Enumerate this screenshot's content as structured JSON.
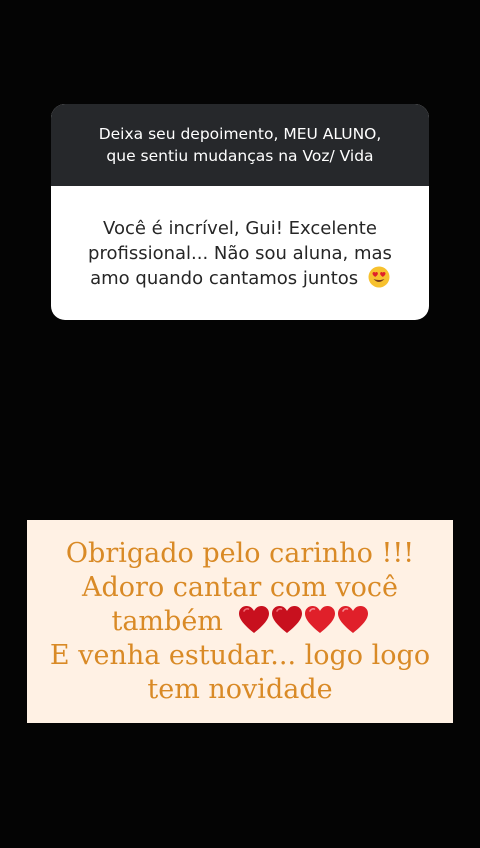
{
  "question_sticker": {
    "lines": [
      "Deixa seu depoimento, MEU ALUNO,",
      "que sentiu mudanças na Voz/ Vida"
    ]
  },
  "answer": {
    "lines": [
      "Você é incrível, Gui! Excelente",
      "profissional... Não sou aluna, mas",
      "amo quando cantamos juntos"
    ],
    "emoji": "heart-eyes-face-icon"
  },
  "reply_text": {
    "line1": "Obrigado pelo carinho !!!",
    "line2": "Adoro cantar com você",
    "line3": "também",
    "line3_emoji": "four-red-hearts-icon",
    "line4": "E venha estudar... logo logo",
    "line5": "tem novidade"
  },
  "colors": {
    "background": "#040404",
    "question_bg": "#26282b",
    "reply_bg": "#fff1e4",
    "reply_text": "#d98a26",
    "heart": "#e0202a"
  }
}
